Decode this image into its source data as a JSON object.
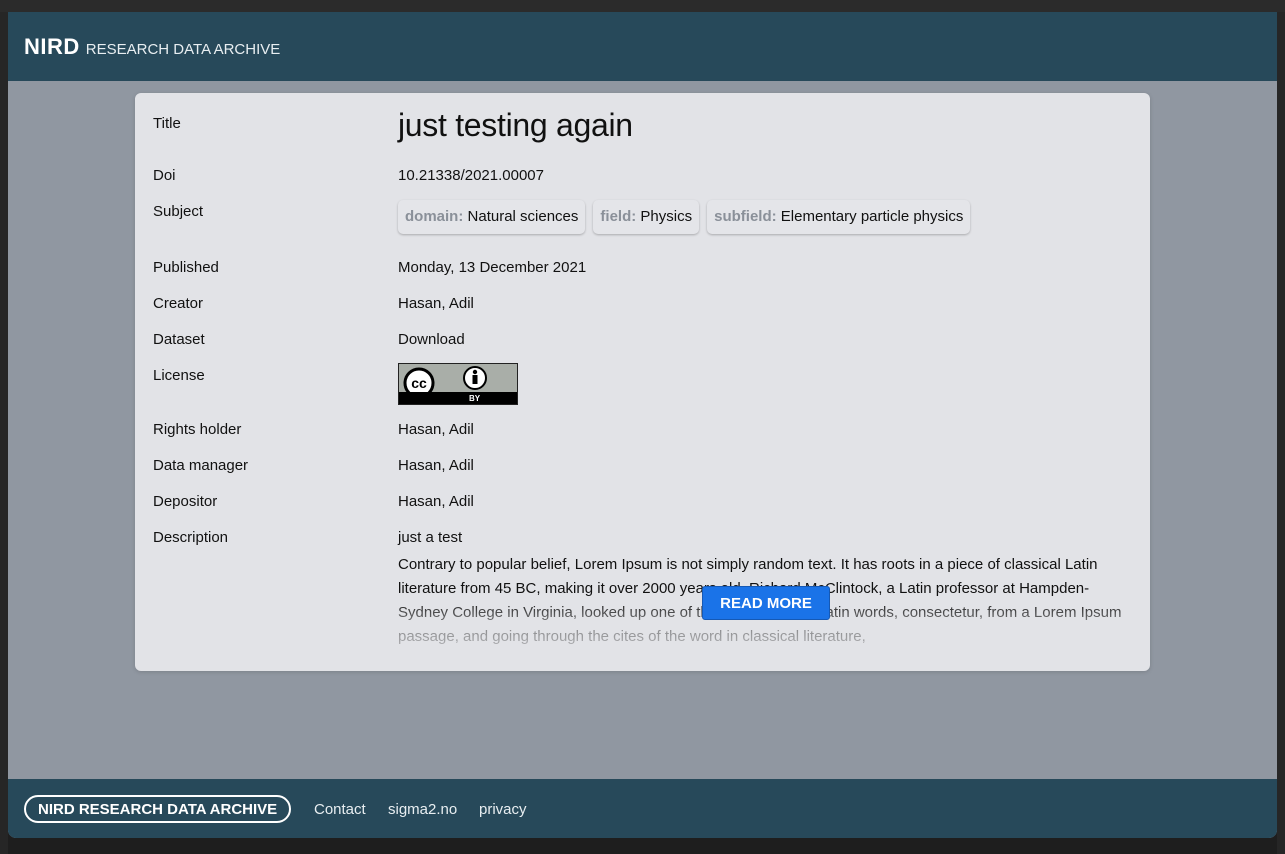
{
  "header": {
    "brand_bold": "NIRD",
    "brand_light": "RESEARCH DATA ARCHIVE"
  },
  "record": {
    "title": {
      "label": "Title",
      "value": "just testing again"
    },
    "doi": {
      "label": "Doi",
      "value": "10.21338/2021.00007"
    },
    "subject": {
      "label": "Subject",
      "chips": [
        {
          "key": "domain:",
          "value": "Natural sciences"
        },
        {
          "key": "field:",
          "value": "Physics"
        },
        {
          "key": "subfield:",
          "value": "Elementary particle physics"
        }
      ]
    },
    "published": {
      "label": "Published",
      "value": "Monday, 13 December 2021"
    },
    "creator": {
      "label": "Creator",
      "value": "Hasan, Adil"
    },
    "dataset": {
      "label": "Dataset",
      "value": "Download"
    },
    "license": {
      "label": "License",
      "badge_cc": "cc",
      "badge_by": "BY"
    },
    "rights_holder": {
      "label": "Rights holder",
      "value": "Hasan, Adil"
    },
    "data_manager": {
      "label": "Data manager",
      "value": "Hasan, Adil"
    },
    "depositor": {
      "label": "Depositor",
      "value": "Hasan, Adil"
    },
    "description": {
      "label": "Description",
      "first_line": "just a test",
      "body": "Contrary to popular belief, Lorem Ipsum is not simply random text. It has roots in a piece of classical Latin literature from 45 BC, making it over 2000 years old. Richard McClintock, a Latin professor at Hampden-Sydney College in Virginia, looked up one of the more obscure Latin words, consectetur, from a Lorem Ipsum passage, and going through the cites of the word in classical literature,"
    },
    "read_more_label": "READ MORE"
  },
  "footer": {
    "brand": "NIRD RESEARCH DATA ARCHIVE",
    "links": [
      "Contact",
      "sigma2.no",
      "privacy"
    ]
  },
  "colors": {
    "header_bg": "#27495a",
    "page_bg": "#9097a1",
    "card_bg": "#e2e3e7",
    "button_bg": "#1a73e8"
  }
}
